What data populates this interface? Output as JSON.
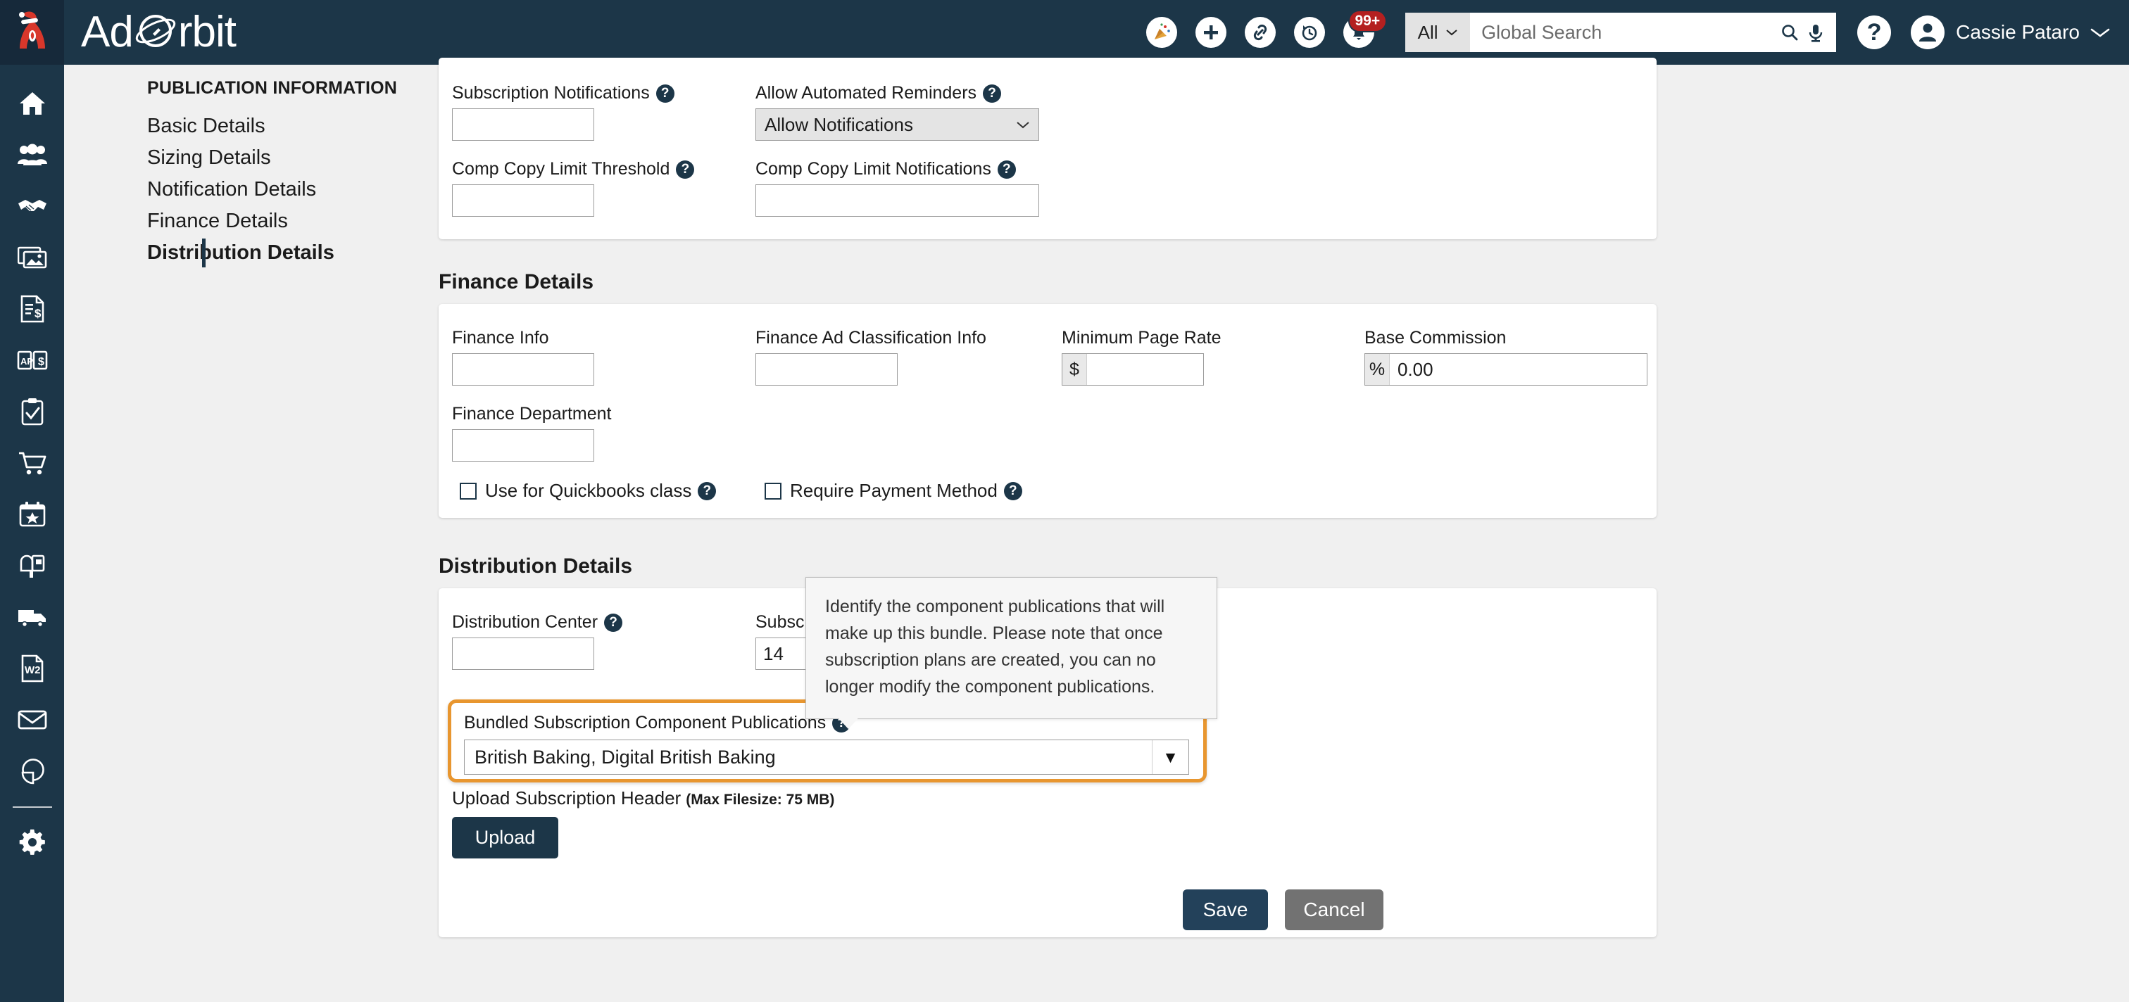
{
  "topbar": {
    "brand": {
      "ad": "Ad",
      "orbit": "rbit"
    },
    "icons": [
      {
        "name": "celebration-icon",
        "label": "Celebrate"
      },
      {
        "name": "plus-icon",
        "label": "Add"
      },
      {
        "name": "link-icon",
        "label": "Links"
      },
      {
        "name": "history-clock-icon",
        "label": "Recent"
      },
      {
        "name": "bell-icon",
        "label": "Notifications"
      }
    ],
    "notification_badge": "99+",
    "search_scope": "All",
    "search_placeholder": "Global Search",
    "help_label": "?",
    "user_name": "Cassie Pataro"
  },
  "rail": {
    "items": [
      {
        "name": "home-icon",
        "label": "Home"
      },
      {
        "name": "people-icon",
        "label": "Contacts"
      },
      {
        "name": "handshake-icon",
        "label": "Deals"
      },
      {
        "name": "photos-icon",
        "label": "Media"
      },
      {
        "name": "invoice-icon",
        "label": "Invoices"
      },
      {
        "name": "ap-book-icon",
        "label": "Accounts Payable"
      },
      {
        "name": "clipboard-check-icon",
        "label": "Tasks"
      },
      {
        "name": "shopping-cart-icon",
        "label": "Orders"
      },
      {
        "name": "calendar-star-icon",
        "label": "Calendar"
      },
      {
        "name": "mailbox-icon",
        "label": "Mailbox"
      },
      {
        "name": "truck-icon",
        "label": "Distribution"
      },
      {
        "name": "w2-document-icon",
        "label": "W2"
      },
      {
        "name": "envelope-icon",
        "label": "Email"
      },
      {
        "name": "pie-chart-icon",
        "label": "Reports"
      },
      {
        "name": "gear-icon",
        "label": "Settings"
      }
    ]
  },
  "subnav": {
    "title": "PUBLICATION INFORMATION",
    "items": [
      {
        "label": "Basic Details",
        "active": false
      },
      {
        "label": "Sizing Details",
        "active": false
      },
      {
        "label": "Notification Details",
        "active": false
      },
      {
        "label": "Finance Details",
        "active": false
      },
      {
        "label": "Distribution Details",
        "active": true
      }
    ]
  },
  "notification_card": {
    "subscription_notifications": {
      "label": "Subscription Notifications",
      "value": ""
    },
    "allow_automated_reminders": {
      "label": "Allow Automated Reminders",
      "value": "Allow Notifications"
    },
    "comp_copy_limit_threshold": {
      "label": "Comp Copy Limit Threshold",
      "value": ""
    },
    "comp_copy_limit_notifications": {
      "label": "Comp Copy Limit Notifications",
      "value": ""
    }
  },
  "finance": {
    "heading": "Finance Details",
    "finance_info": {
      "label": "Finance Info",
      "value": ""
    },
    "finance_ad_classification_info": {
      "label": "Finance Ad Classification Info",
      "value": ""
    },
    "minimum_page_rate": {
      "label": "Minimum Page Rate",
      "prefix": "$",
      "value": ""
    },
    "base_commission": {
      "label": "Base Commission",
      "prefix": "%",
      "value": "0.00"
    },
    "finance_department": {
      "label": "Finance Department",
      "value": ""
    },
    "use_for_quickbooks_class": {
      "label": "Use for Quickbooks class",
      "checked": false
    },
    "require_payment_method": {
      "label": "Require Payment Method",
      "checked": false
    }
  },
  "distribution": {
    "heading": "Distribution Details",
    "distribution_center": {
      "label": "Distribution Center",
      "value": ""
    },
    "subscription_field": {
      "label": "Subscr",
      "value": "14"
    },
    "bundled_component_publications": {
      "label": "Bundled Subscription Component Publications",
      "value": "British Baking, Digital British Baking"
    },
    "tooltip": "Identify the component publications that will make up this bundle. Please note that once subscription plans are created, you can no longer modify the component publications.",
    "upload_caption": "Upload Subscription Header",
    "upload_limit": "(Max Filesize: 75 MB)",
    "upload_button": "Upload"
  },
  "footer": {
    "save": "Save",
    "cancel": "Cancel"
  },
  "colors": {
    "navy": "#1c3648",
    "highlight_orange": "#e8962f",
    "badge_red": "#b42020",
    "page_bg": "#f0f0f0"
  }
}
